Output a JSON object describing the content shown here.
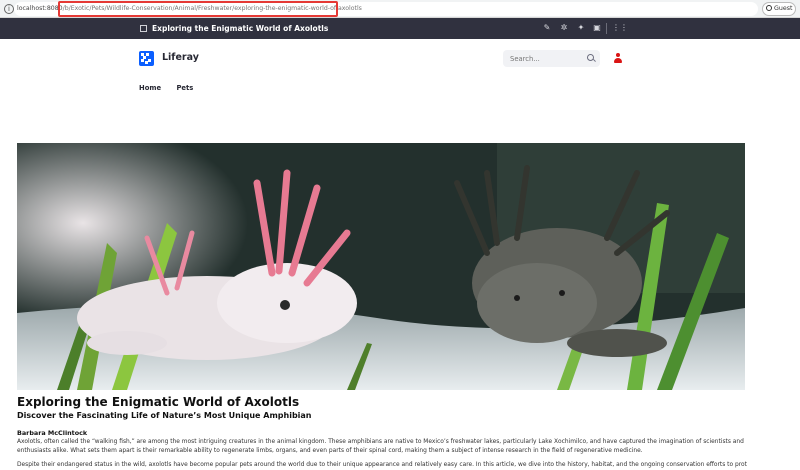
{
  "browser": {
    "url_host": "localhost:8080",
    "url_path": "/b/Exotic/Pets/Wildlife-Conservation/Animal/Freshwater/exploring-the-enigmatic-world-of-axolotls",
    "profile_label": "Guest"
  },
  "control_bar": {
    "page_title": "Exploring the Enigmatic World of Axolotls",
    "icons": [
      "pencil-icon",
      "gear-icon",
      "compass-icon",
      "simulation-icon",
      "apps-grid-icon"
    ]
  },
  "site": {
    "name": "Liferay",
    "search_placeholder": "Search...",
    "nav_items": [
      "Home",
      "Pets"
    ],
    "brand_color": "#0b5fff",
    "user_icon_color": "#da1414"
  },
  "article": {
    "hero_alt": "Two axolotls, one pink leucistic and one dark wild-type, resting on white sand among aquatic plants",
    "title": "Exploring the Enigmatic World of Axolotls",
    "subtitle": "Discover the Fascinating Life of Nature’s Most Unique Amphibian",
    "author": "Barbara McClintock",
    "paragraph1": "Axolotls, often called the “walking fish,” are among the most intriguing creatures in the animal kingdom. These amphibians are native to Mexico’s freshwater lakes, particularly Lake Xochimilco, and have captured the imagination of scientists and enthusiasts alike. What sets them apart is their remarkable ability to regenerate limbs, organs, and even parts of their spinal cord, making them a subject of intense research in the field of regenerative medicine.",
    "paragraph2": "Despite their endangered status in the wild, axolotls have become popular pets around the world due to their unique appearance and relatively easy care. In this article, we dive into the history, habitat, and the ongoing conservation efforts to protect this"
  }
}
